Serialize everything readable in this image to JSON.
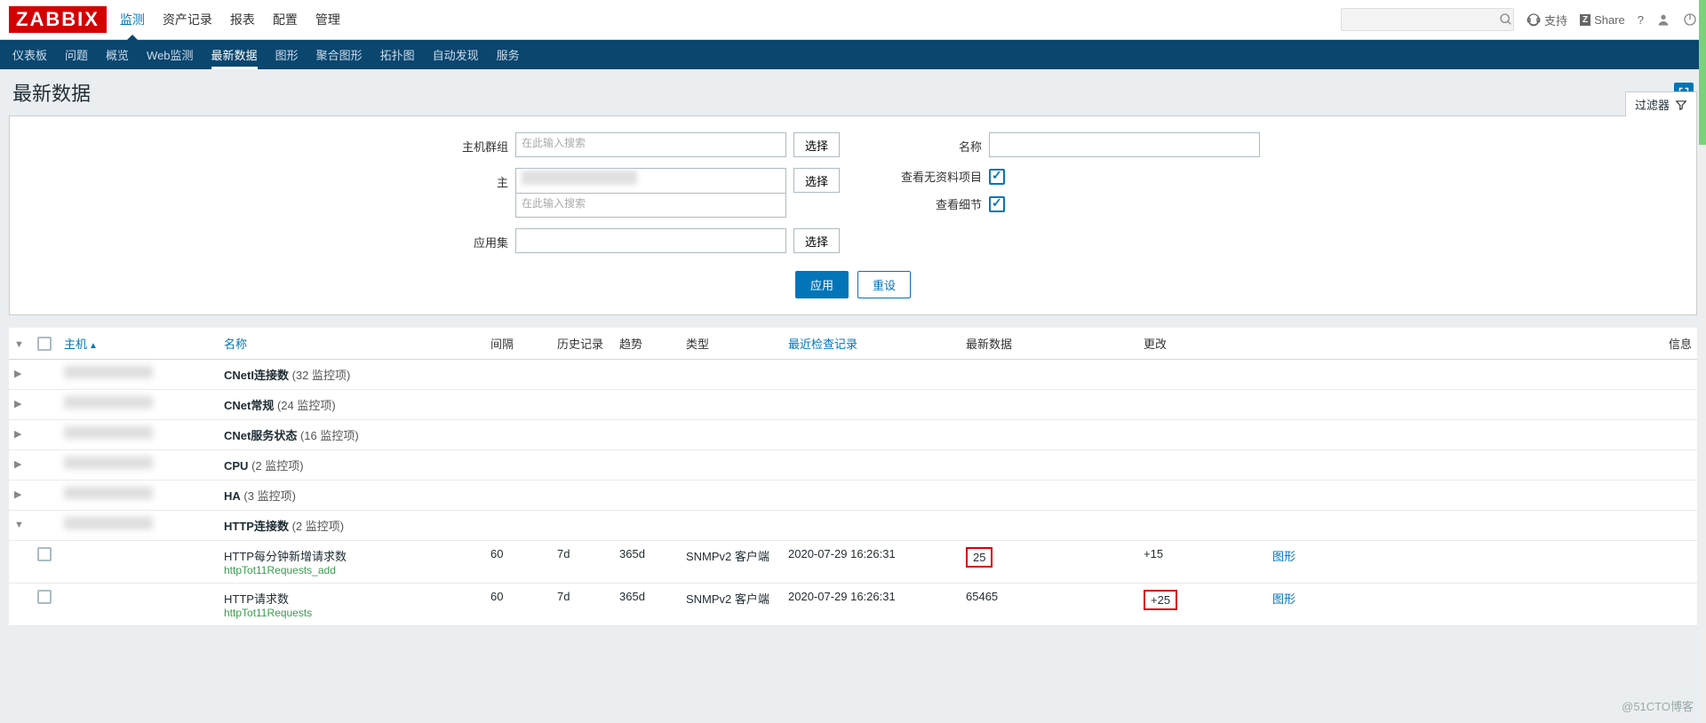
{
  "logo": "ZABBIX",
  "mainnav": [
    "监测",
    "资产记录",
    "报表",
    "配置",
    "管理"
  ],
  "mainnav_active": 0,
  "topbar": {
    "support": "支持",
    "share": "Share",
    "share_badge": "Z"
  },
  "subnav": [
    "仪表板",
    "问题",
    "概览",
    "Web监测",
    "最新数据",
    "图形",
    "聚合图形",
    "拓扑图",
    "自动发现",
    "服务"
  ],
  "subnav_active": 4,
  "page_title": "最新数据",
  "filter": {
    "tab_label": "过滤器",
    "labels": {
      "hostgroup": "主机群组",
      "host": "主",
      "application": "应用集",
      "name": "名称",
      "show_nodata": "查看无资料项目",
      "show_detail": "查看细节"
    },
    "placeholder": "在此输入搜索",
    "select_btn": "选择",
    "apply": "应用",
    "reset": "重设",
    "show_nodata_checked": true,
    "show_detail_checked": true
  },
  "table": {
    "headers": {
      "host": "主机",
      "name": "名称",
      "interval": "间隔",
      "history": "历史记录",
      "trends": "趋势",
      "type": "类型",
      "lastcheck": "最近检查记录",
      "lastvalue": "最新数据",
      "change": "更改",
      "info": "信息"
    },
    "groups": [
      {
        "expanded": false,
        "app": "CNetI连接数",
        "count": "(32 监控项)"
      },
      {
        "expanded": false,
        "app": "CNet常规",
        "count": "(24 监控项)"
      },
      {
        "expanded": false,
        "app": "CNet服务状态",
        "count": "(16 监控项)"
      },
      {
        "expanded": false,
        "app": "CPU",
        "count": "(2 监控项)"
      },
      {
        "expanded": false,
        "app": "HA",
        "count": "(3 监控项)"
      },
      {
        "expanded": true,
        "app": "HTTP连接数",
        "count": "(2 监控项)"
      }
    ],
    "items": [
      {
        "name": "HTTP每分钟新增请求数",
        "key": "httpTot11Requests_add",
        "interval": "60",
        "history": "7d",
        "trends": "365d",
        "type": "SNMPv2 客户端",
        "lastcheck": "2020-07-29 16:26:31",
        "lastvalue": "25",
        "lastvalue_highlight": true,
        "change": "+15",
        "change_highlight": false,
        "graph": "图形"
      },
      {
        "name": "HTTP请求数",
        "key": "httpTot11Requests",
        "interval": "60",
        "history": "7d",
        "trends": "365d",
        "type": "SNMPv2 客户端",
        "lastcheck": "2020-07-29 16:26:31",
        "lastvalue": "65465",
        "lastvalue_highlight": false,
        "change": "+25",
        "change_highlight": true,
        "graph": "图形"
      }
    ]
  },
  "watermark": "@51CTO博客"
}
